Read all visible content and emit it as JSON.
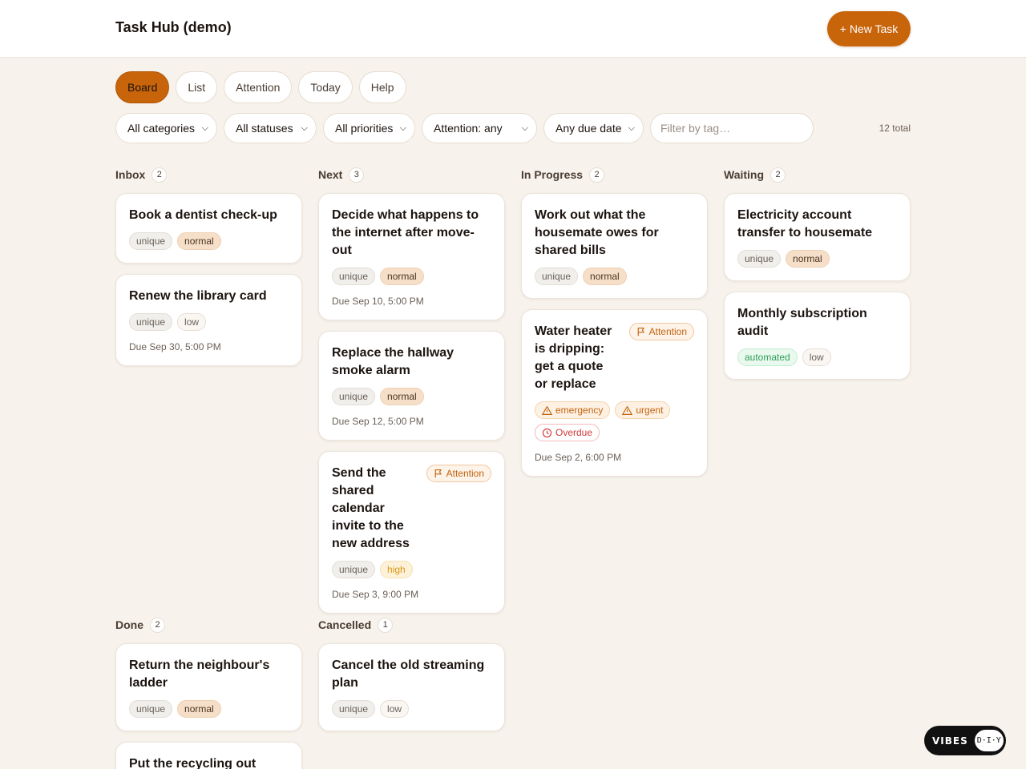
{
  "app": {
    "title": "Task Hub (demo)",
    "new_task_label": "+ New Task"
  },
  "tabs": [
    "Board",
    "List",
    "Attention",
    "Today",
    "Help"
  ],
  "active_tab": "Board",
  "filters": {
    "category": "All categories",
    "status": "All statuses",
    "priority": "All priorities",
    "attention": "Attention: any",
    "due": "Any due date",
    "tag_placeholder": "Filter by tag…",
    "total": "12 total"
  },
  "columns": {
    "inbox": {
      "title": "Inbox",
      "count": "2",
      "cards": [
        {
          "title": "Book a dentist check-up",
          "tags": [
            "unique",
            "normal"
          ]
        },
        {
          "title": "Renew the library card",
          "tags": [
            "unique",
            "low"
          ],
          "due": "Due Sep 30, 5:00 PM"
        }
      ]
    },
    "next": {
      "title": "Next",
      "count": "3",
      "cards": [
        {
          "title": "Decide what happens to the internet after move-out",
          "tags": [
            "unique",
            "normal"
          ],
          "due": "Due Sep 10, 5:00 PM"
        },
        {
          "title": "Replace the hallway smoke alarm",
          "tags": [
            "unique",
            "normal"
          ],
          "due": "Due Sep 12, 5:00 PM"
        },
        {
          "title": "Send the shared calendar invite to the new address",
          "attention": "Attention",
          "tags": [
            "unique",
            "high"
          ],
          "due": "Due Sep 3, 9:00 PM"
        }
      ]
    },
    "in_progress": {
      "title": "In Progress",
      "count": "2",
      "cards": [
        {
          "title": "Work out what the housemate owes for shared bills",
          "tags": [
            "unique",
            "normal"
          ]
        },
        {
          "title": "Water heater is dripping: get a quote or replace",
          "attention": "Attention",
          "tags": [
            "emergency",
            "urgent",
            "Overdue"
          ],
          "due": "Due Sep 2, 6:00 PM"
        }
      ]
    },
    "waiting": {
      "title": "Waiting",
      "count": "2",
      "cards": [
        {
          "title": "Electricity account transfer to housemate",
          "tags": [
            "unique",
            "normal"
          ]
        },
        {
          "title": "Monthly subscription audit",
          "tags": [
            "automated",
            "low"
          ]
        }
      ]
    },
    "done": {
      "title": "Done",
      "count": "2",
      "cards": [
        {
          "title": "Return the neighbour's ladder",
          "tags": [
            "unique",
            "normal"
          ]
        },
        {
          "title": "Put the recycling out"
        }
      ]
    },
    "cancelled": {
      "title": "Cancelled",
      "count": "1",
      "cards": [
        {
          "title": "Cancel the old streaming plan",
          "tags": [
            "unique",
            "low"
          ]
        }
      ]
    }
  },
  "badge": {
    "vibes": "VIBES",
    "diy": "D·I·Y"
  },
  "icons": {
    "attention": "flag-icon",
    "emergency": "warning-icon",
    "overdue": "clock-icon",
    "select": "chevron-down-icon"
  },
  "colors": {
    "accent": "#c8640a",
    "background": "#f7f2ec"
  }
}
